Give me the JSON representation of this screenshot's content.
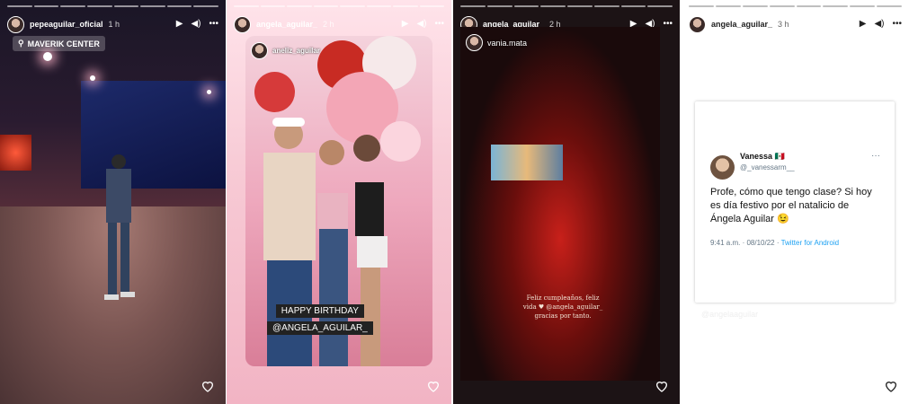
{
  "stories": [
    {
      "username": "pepeaguilar_oficial",
      "time": "1 h",
      "location": "MAVERIK CENTER"
    },
    {
      "username": "angela_aguilar_",
      "time": "2 h",
      "mention": "aneliz_aguilar",
      "caption_line1": "HAPPY BIRTHDAY",
      "caption_line2": "@ANGELA_AGUILAR_"
    },
    {
      "username": "angela_aguilar_",
      "time": "2 h",
      "mention": "vania.mata",
      "caption_line1": "Feliz cumpleaños, feliz",
      "caption_line2": "vida ♥ @angela_aguilar_",
      "caption_line3": "gracias por tanto."
    },
    {
      "username": "angela_aguilar_",
      "time": "3 h",
      "tweet": {
        "name": "Vanessa 🇲🇽",
        "handle": "@_vanessarm__",
        "text": "Profe, cómo que tengo clase? Si hoy es día festivo por el natalicio de Ángela Aguilar 😉",
        "date": "9:41 a.m. · 08/10/22 · ",
        "source": "Twitter for Android"
      },
      "watermark": "@angelaaguilar"
    }
  ],
  "icons": {
    "play": "play-icon",
    "volume": "volume-icon",
    "more": "more-icon",
    "like": "heart-icon",
    "location": "location-pin-icon"
  }
}
